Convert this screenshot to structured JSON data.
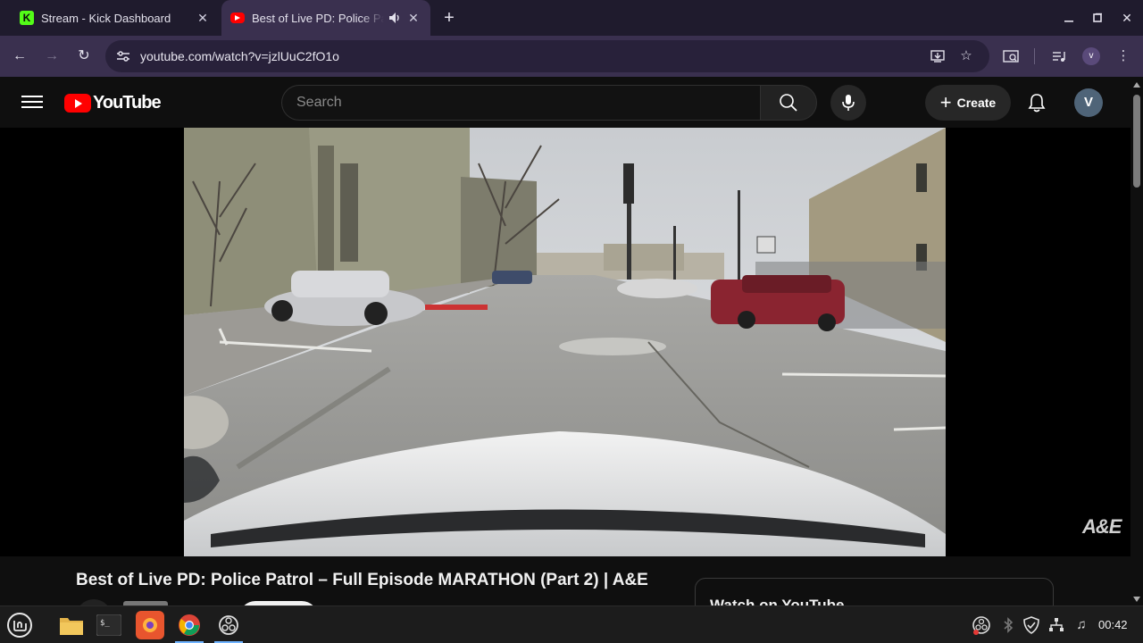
{
  "browser": {
    "tabs": [
      {
        "title": "Stream - Kick Dashboard",
        "favicon": "kick-icon",
        "active": false
      },
      {
        "title": "Best of Live PD: Police Pa",
        "favicon": "youtube-icon",
        "active": true,
        "audio": true
      }
    ],
    "url": "youtube.com/watch?v=jzlUuC2fO1o",
    "profile_initial": "v"
  },
  "youtube": {
    "logo_text": "YouTube",
    "search_placeholder": "Search",
    "create_label": "Create",
    "avatar_initial": "V"
  },
  "video": {
    "title": "Best of Live PD: Police Patrol – Full Episode MARATHON (Part 2) | A&E",
    "watermark": "A&E"
  },
  "watch_card": {
    "label": "Watch on YouTube"
  },
  "taskbar": {
    "clock": "00:42"
  },
  "colors": {
    "youtube_red": "#ff0000",
    "kick_green": "#53fc18",
    "tab_active": "#3a304f",
    "tab_strip": "#1f1b2d"
  }
}
